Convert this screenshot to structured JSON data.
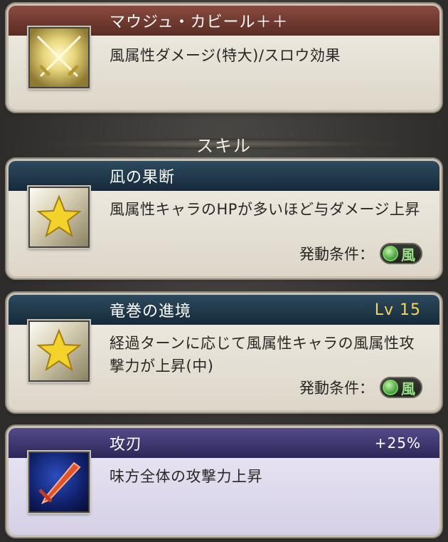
{
  "weapon": {
    "title": "マウジュ・カビール＋＋",
    "description": "風属性ダメージ(特大)/スロウ効果",
    "icon": "crossed-swords-icon"
  },
  "section_title": "スキル",
  "skills": [
    {
      "name": "凪の果断",
      "level": "",
      "description": "風属性キャラのHPが多いほど与ダメージ上昇",
      "condition_label": "発動条件：",
      "element": "風",
      "icon": "star-icon"
    },
    {
      "name": "竜巻の進境",
      "level": "Lv 15",
      "description": "経過ターンに応じて風属性キャラの風属性攻撃力が上昇(中)",
      "condition_label": "発動条件：",
      "element": "風",
      "icon": "star-icon"
    },
    {
      "name": "攻刃",
      "bonus": "+25%",
      "description": "味方全体の攻撃力上昇",
      "icon": "blade-icon"
    }
  ],
  "colors": {
    "weapon_header": "#6e382f",
    "skill_header": "#1f3a4c",
    "support_header": "#3e3672",
    "level_text": "#f5d65a",
    "element_wind": "#9be28a"
  }
}
